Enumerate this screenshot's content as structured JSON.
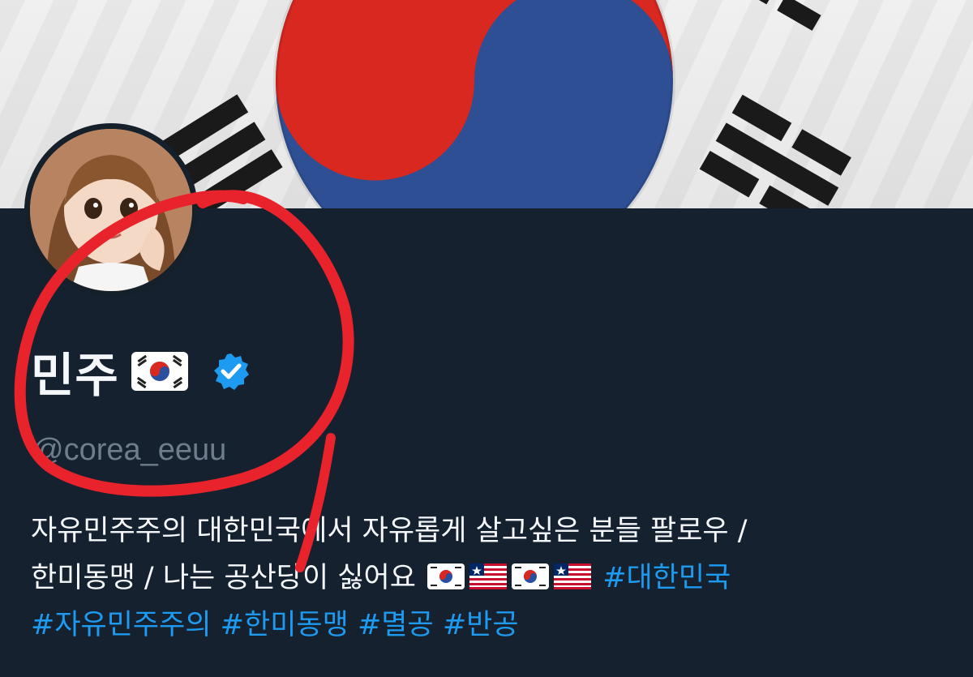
{
  "profile": {
    "display_name": "민주",
    "handle": "@corea_eeuu",
    "verified": true
  },
  "bio": {
    "line1_text": "자유민주주의 대한민국에서 자유롭게 살고싶은 분들 팔로우  /",
    "line2_text": "한미동맹 /  나는 공산당이 싫어요",
    "hashtags": [
      "#대한민국",
      "#자유민주주의",
      "#한미동맹",
      "#멸공",
      "#반공"
    ]
  },
  "icons": {
    "flag_korea": "south-korea-flag-icon",
    "flag_liberia": "liberia-flag-icon",
    "verified": "verified-badge-icon"
  },
  "colors": {
    "background": "#15202b",
    "hashtag": "#1d9bf0",
    "verified": "#1d9bf0",
    "annotation": "#e8232b"
  }
}
